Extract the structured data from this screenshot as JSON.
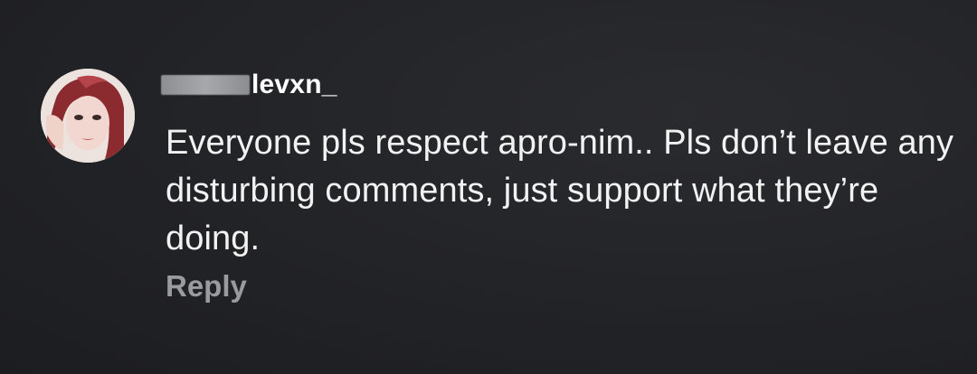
{
  "comment": {
    "username": "levxn_",
    "text": "Everyone pls respect apro-nim.. Pls don’t leave any disturbing comments, just support what they’re doing.",
    "reply_label": "Reply"
  },
  "colors": {
    "background": "#222327",
    "text": "#f2f2f2",
    "username": "#ffffff",
    "reply": "#9a9b9f",
    "redaction": "#a7a8ac"
  },
  "icons": {
    "avatar": "user-avatar-photo"
  }
}
